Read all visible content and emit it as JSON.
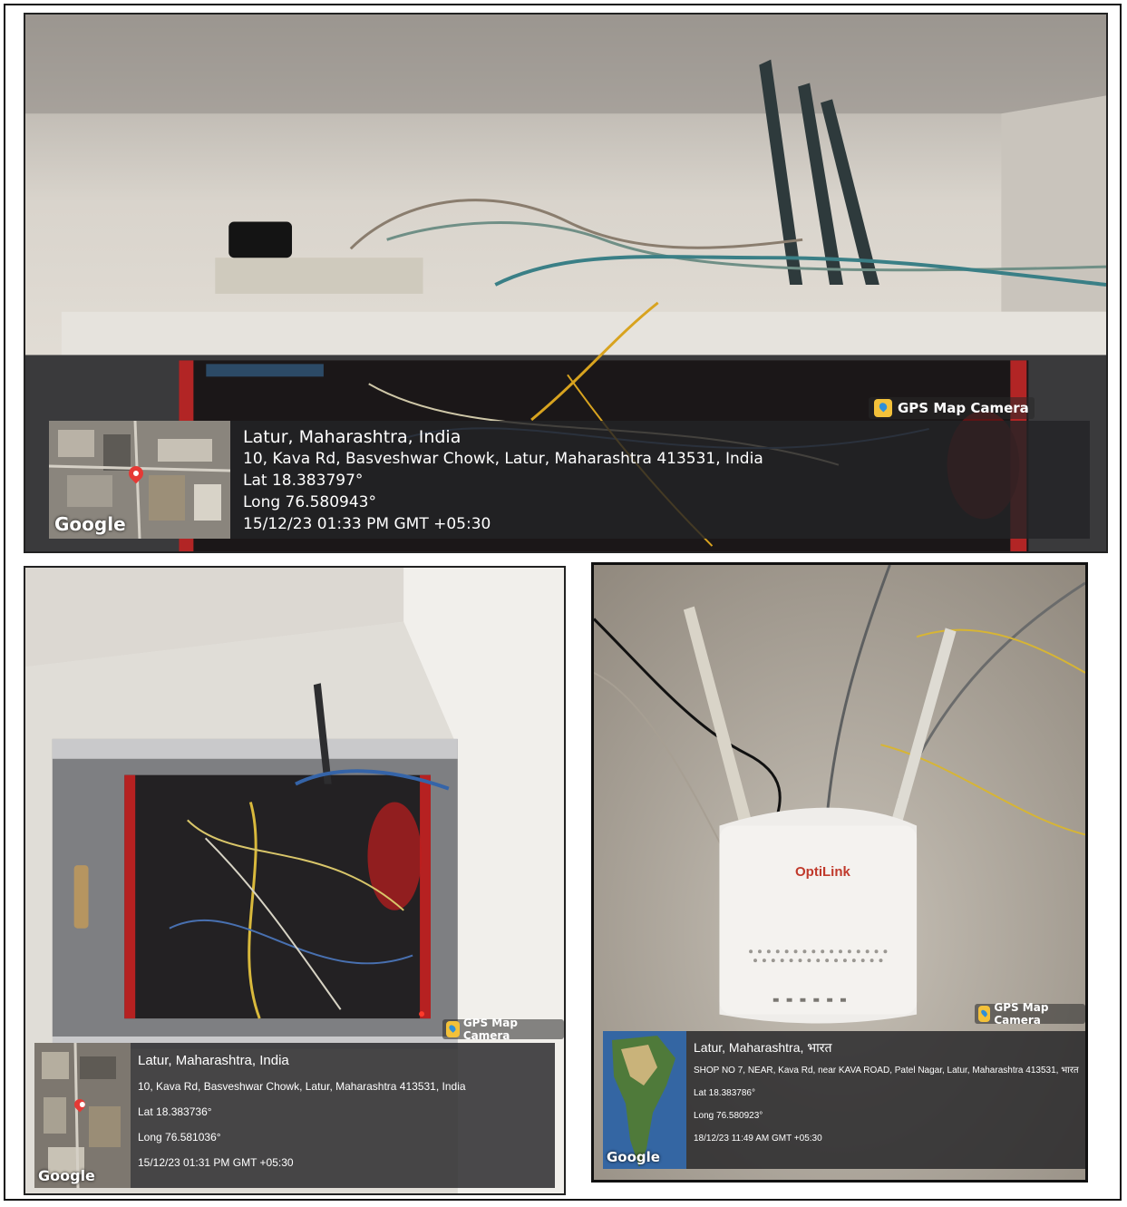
{
  "photos": {
    "top": {
      "badge": "GPS Map Camera",
      "map_label": "Google",
      "lines": [
        "Latur, Maharashtra, India",
        "10, Kava Rd, Basveshwar Chowk, Latur, Maharashtra 413531, India",
        "Lat 18.383797°",
        "Long 76.580943°",
        "15/12/23 01:33 PM GMT +05:30"
      ]
    },
    "bottom_left": {
      "badge": "GPS Map Camera",
      "map_label": "Google",
      "lines": [
        "Latur, Maharashtra, India",
        "10, Kava Rd, Basveshwar Chowk, Latur, Maharashtra 413531, India",
        "Lat 18.383736°",
        "Long 76.581036°",
        "15/12/23 01:31 PM GMT +05:30"
      ]
    },
    "bottom_right": {
      "badge": "GPS Map Camera",
      "map_label": "Google",
      "router_brand": "OptiLink",
      "lines": [
        "Latur, Maharashtra, भारत",
        "SHOP NO 7, NEAR, Kava Rd, near KAVA ROAD, Patel Nagar, Latur, Maharashtra 413531, भारत",
        "Lat 18.383786°",
        "Long 76.580923°",
        "18/12/23 11:49 AM GMT +05:30"
      ]
    }
  },
  "colors": {
    "overlay_bg": "#232326",
    "badge_icon": "#f3c13a",
    "pin": "#e53935"
  }
}
